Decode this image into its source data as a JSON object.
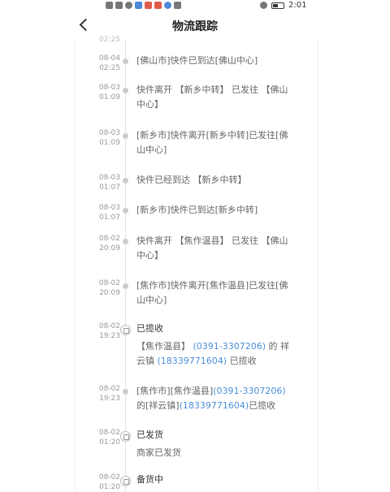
{
  "status_bar": {
    "time": "2:01"
  },
  "header": {
    "title": "物流跟踪"
  },
  "partial_time": "02:25",
  "events": [
    {
      "date": "08-04",
      "time": "02:25",
      "parts": [
        {
          "t": "[佛山市]快件已到达[佛山中心]"
        }
      ]
    },
    {
      "date": "08-03",
      "time": "01:09",
      "parts": [
        {
          "t": "快件离开 【新乡中转】 已发往 【佛山中心】"
        }
      ]
    },
    {
      "date": "08-03",
      "time": "01:09",
      "parts": [
        {
          "t": "[新乡市]快件离开[新乡中转]已发往[佛山中心]"
        }
      ]
    },
    {
      "date": "08-03",
      "time": "01:07",
      "parts": [
        {
          "t": "快件已经到达 【新乡中转】"
        }
      ]
    },
    {
      "date": "08-03",
      "time": "01:07",
      "parts": [
        {
          "t": "[新乡市]快件已到达[新乡中转]"
        }
      ]
    },
    {
      "date": "08-02",
      "time": "20:09",
      "parts": [
        {
          "t": "快件离开 【焦作温县】 已发往 【佛山中心】"
        }
      ]
    },
    {
      "date": "08-02",
      "time": "20:09",
      "parts": [
        {
          "t": "[焦作市]快件离开[焦作温县]已发往[佛山中心]"
        }
      ]
    },
    {
      "date": "08-02",
      "time": "19:23",
      "title": "已揽收",
      "parts": [
        {
          "t": "【焦作温县】 "
        },
        {
          "t": "(0391-3307206)",
          "link": true
        },
        {
          "t": " 的 祥云镇 "
        },
        {
          "t": "(18339771604)",
          "link": true
        },
        {
          "t": " 已揽收"
        }
      ]
    },
    {
      "date": "08-02",
      "time": "19:23",
      "parts": [
        {
          "t": "[焦作市][焦作温县]"
        },
        {
          "t": "(0391-3307206)",
          "link": true
        },
        {
          "t": "的[祥云镇]"
        },
        {
          "t": "(18339771604)",
          "link": true
        },
        {
          "t": "已揽收"
        }
      ]
    },
    {
      "date": "08-02",
      "time": "01:20",
      "title": "已发货",
      "parts": [
        {
          "t": "商家已发货"
        }
      ]
    },
    {
      "date": "08-02",
      "time": "01:20",
      "title": "备货中",
      "parts": []
    }
  ],
  "colors": {
    "link": "#4a8ed8",
    "timeline": "#e3e3e3"
  }
}
